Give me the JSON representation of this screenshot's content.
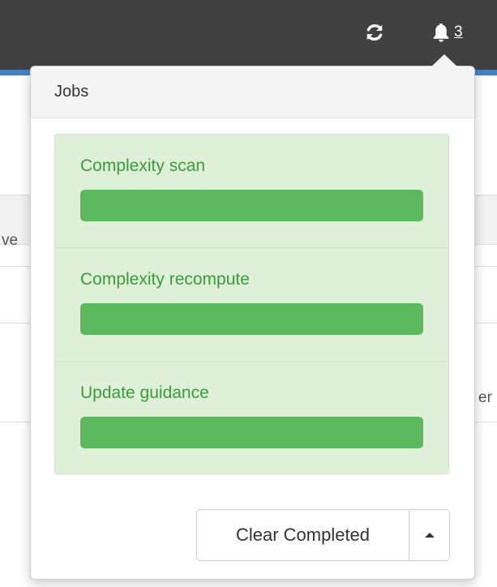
{
  "navbar": {
    "notification_count": "3",
    "refresh_icon": "refresh-icon",
    "bell_icon": "bell-icon"
  },
  "background": {
    "fragment_left": "ve",
    "fragment_right": "er"
  },
  "popover": {
    "title": "Jobs",
    "jobs": [
      {
        "name": "Complexity scan",
        "progress": 1.0
      },
      {
        "name": "Complexity recompute",
        "progress": 1.0
      },
      {
        "name": "Update guidance",
        "progress": 1.0
      }
    ],
    "clear_label": "Clear Completed",
    "toggle_icon": "caret-up-icon"
  },
  "colors": {
    "navbar": "#414141",
    "accent": "#4a7fc5",
    "success_bg": "#dff0d8",
    "success_text": "#3c9a3c",
    "progress": "#5cb85c"
  }
}
